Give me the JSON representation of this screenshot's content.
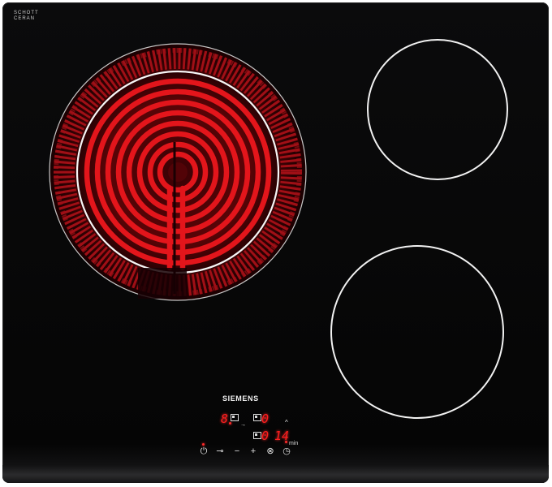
{
  "logo": {
    "line1": "SCHOTT",
    "line2": "CERAN",
    "line3": ""
  },
  "brand": "SIEMENS",
  "display": {
    "zone_level": "8",
    "timer_zone": "0",
    "timer_zone2": "0",
    "timer_minutes": "14",
    "min_label": "min"
  },
  "controls": {
    "power": "⏻",
    "lock": "⊸",
    "minus": "−",
    "plus": "+",
    "zone_select": "⊗",
    "timer": "◷",
    "chevron": "^"
  },
  "colors": {
    "glass": "#080808",
    "heating_red": "#e0141a",
    "zone_outline": "#f4f4f4",
    "display_red": "#ff1e1e"
  },
  "zones": [
    {
      "name": "front-left-dual-zone",
      "state": "on"
    },
    {
      "name": "back-right-zone",
      "state": "off"
    },
    {
      "name": "front-right-zone",
      "state": "off"
    }
  ]
}
